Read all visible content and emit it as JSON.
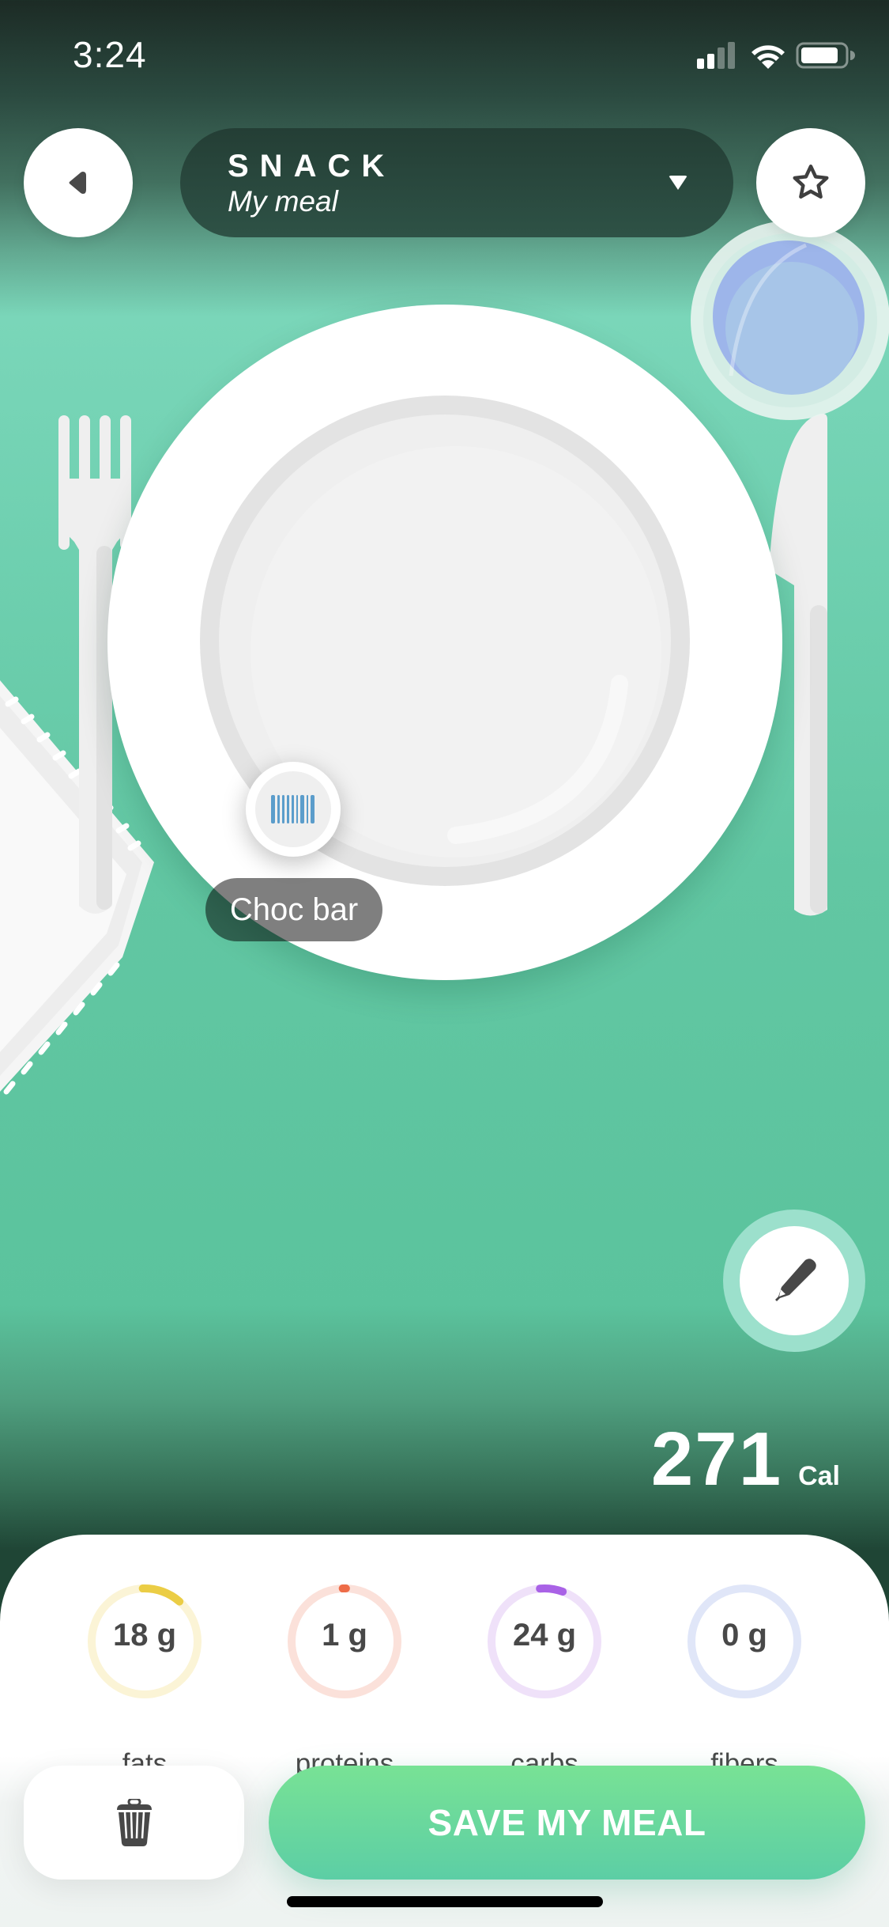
{
  "status_bar": {
    "time": "3:24",
    "signal_bars_active": 2,
    "signal_bars_total": 4,
    "icons": [
      "cellular-signal-icon",
      "wifi-icon",
      "battery-icon"
    ]
  },
  "header": {
    "back_icon": "back-triangle-icon",
    "meal_type": "SNACK",
    "meal_name": "My meal",
    "dropdown_icon": "caret-down-icon",
    "favorite_icon": "star-outline-icon"
  },
  "plate": {
    "items": [
      {
        "label": "Choc bar",
        "icon": "barcode-icon"
      }
    ]
  },
  "edit_icon": "pencil-icon",
  "calories": {
    "value": "271",
    "unit": "Cal"
  },
  "macros": [
    {
      "key": "fats",
      "value": "18 g",
      "label": "fats",
      "progress": 0.12,
      "color": "#ebcd45",
      "track": "#fbf4d6"
    },
    {
      "key": "proteins",
      "value": "1 g",
      "label": "proteins",
      "progress": 0.01,
      "color": "#ee6c48",
      "track": "#fbe1da"
    },
    {
      "key": "carbs",
      "value": "24 g",
      "label": "carbs",
      "progress": 0.07,
      "color": "#a962e6",
      "track": "#efe1f9"
    },
    {
      "key": "fibers",
      "value": "0 g",
      "label": "fibers",
      "progress": 0,
      "color": "#8ea4e8",
      "track": "#e0e6f8"
    }
  ],
  "actions": {
    "delete_icon": "trash-icon",
    "save_label": "SAVE MY MEAL"
  },
  "colors": {
    "accent_green": "#5ccea5",
    "header_pill": "#2b4a40",
    "water": "#a5c4ea"
  }
}
